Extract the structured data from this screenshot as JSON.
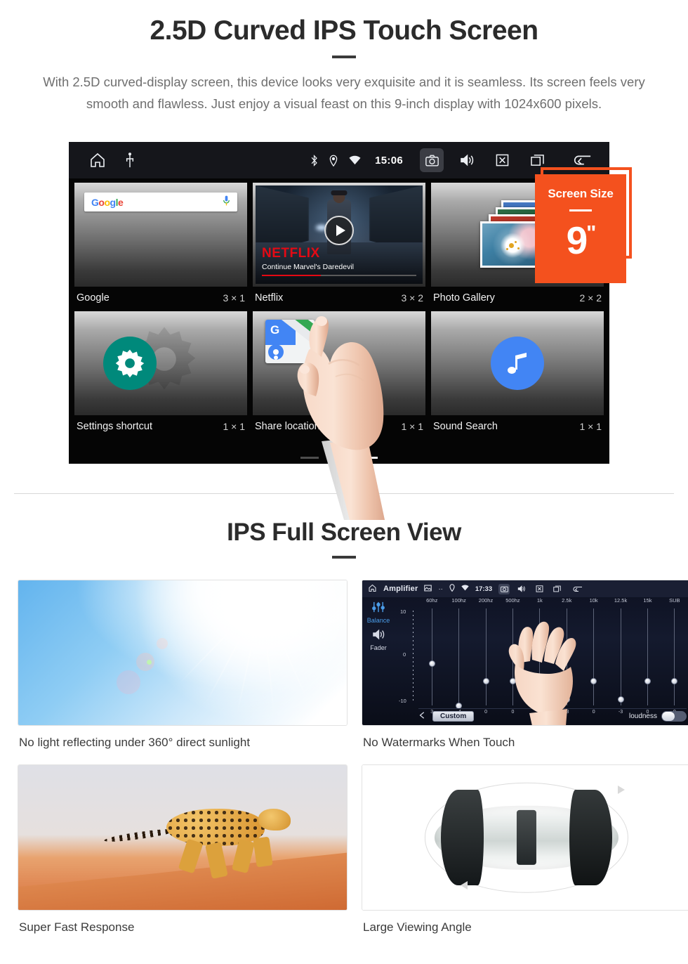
{
  "section1": {
    "title": "2.5D Curved IPS Touch Screen",
    "description": "With 2.5D curved-display screen, this device looks very exquisite and it is seamless. Its screen feels very smooth and flawless. Just enjoy a visual feast on this 9-inch display with 1024x600 pixels."
  },
  "device": {
    "statusbar": {
      "home_icon": "home-icon",
      "usb_icon": "usb-icon",
      "bluetooth_icon": "bluetooth-icon",
      "location_icon": "location-pin-icon",
      "wifi_icon": "wifi-icon",
      "time": "15:06",
      "camera_icon": "camera-icon",
      "volume_icon": "volume-icon",
      "close_icon": "close-box-icon",
      "recents_icon": "recent-apps-icon",
      "back_icon": "back-arrow-icon"
    },
    "widgets": [
      {
        "name": "Google",
        "size": "3 × 1",
        "search_placeholder": "",
        "logo": "Google",
        "mic_icon": "microphone-icon"
      },
      {
        "name": "Netflix",
        "size": "3 × 2",
        "brand": "NETFLIX",
        "subtitle": "Continue Marvel's Daredevil",
        "play_icon": "play-icon"
      },
      {
        "name": "Photo Gallery",
        "size": "2 × 2"
      },
      {
        "name": "Settings shortcut",
        "size": "1 × 1",
        "icon": "gear-icon"
      },
      {
        "name": "Share location",
        "size": "1 × 1",
        "icon": "google-maps-icon"
      },
      {
        "name": "Sound Search",
        "size": "1 × 1",
        "icon": "music-note-icon"
      }
    ],
    "page_indicator": {
      "count": 3,
      "active": 3
    }
  },
  "badge": {
    "label": "Screen Size",
    "value": "9",
    "unit": "\"",
    "color": "#f4511e"
  },
  "section2": {
    "title": "IPS Full Screen View",
    "tiles": [
      {
        "caption": "No light reflecting under 360° direct sunlight",
        "image": "sunny-sky-photo"
      },
      {
        "caption": "No Watermarks When Touch",
        "image": "amplifier-equalizer-screenshot"
      },
      {
        "caption": "Super Fast Response",
        "image": "running-cheetah-photo"
      },
      {
        "caption": "Large Viewing Angle",
        "image": "car-top-view-illustration"
      }
    ]
  },
  "amplifier": {
    "statusbar": {
      "home_icon": "home-icon",
      "title": "Amplifier",
      "gallery_icon": "gallery-icon",
      "dots_icon": "more-icon",
      "location_icon": "location-pin-icon",
      "wifi_icon": "wifi-icon",
      "time": "17:33",
      "camera_icon": "camera-icon",
      "volume_icon": "volume-icon",
      "close_icon": "close-box-icon",
      "recents_icon": "recent-apps-icon",
      "back_icon": "back-arrow-icon"
    },
    "side": {
      "balance_label": "Balance",
      "balance_icon": "sliders-icon",
      "fader_label": "Fader",
      "fader_icon": "speaker-icon"
    },
    "scale": {
      "top": "10",
      "mid": "0",
      "bottom": "-10"
    },
    "bands": [
      "60hz",
      "100hz",
      "200hz",
      "500hz",
      "1k",
      "2.5k",
      "10k",
      "12.5k",
      "15k",
      "SUB"
    ],
    "values": [
      3,
      -4,
      0,
      0,
      0,
      -3,
      0,
      -3,
      0,
      0
    ],
    "preset_button": "Custom",
    "prev_icon": "chevron-left-icon",
    "loudness_label": "loudness",
    "loudness_on": false
  }
}
